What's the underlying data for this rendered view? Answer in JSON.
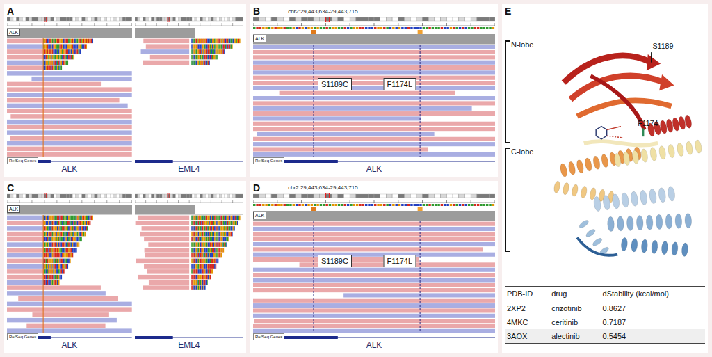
{
  "panels": [
    {
      "label": "A",
      "kind": "fusion",
      "regions": [
        {
          "gene": "ALK",
          "track": "ALK",
          "gene_track": "RefSeq Genes",
          "mode": "left",
          "split_reads": 6,
          "reads": [
            true,
            false,
            true,
            true,
            false,
            true,
            false,
            false,
            true,
            true,
            false,
            true,
            false,
            true,
            true,
            false,
            true,
            false,
            true,
            false,
            true,
            true
          ]
        },
        {
          "gene": "EML4",
          "track": "",
          "gene_track": "",
          "mode": "right",
          "split_reads": 5,
          "reads": [
            true,
            true,
            false,
            true,
            true,
            false,
            true,
            false,
            true,
            true,
            false,
            true,
            false,
            true,
            true,
            false,
            true,
            false,
            true,
            false,
            true,
            true
          ]
        }
      ]
    },
    {
      "label": "B",
      "kind": "variant",
      "coord": "chr2:29,443,634-29,443,715",
      "gene": "ALK",
      "track": "ALK",
      "gene_track": "RefSeq Genes",
      "variants": [
        {
          "label": "S1189C"
        },
        {
          "label": "F1174L"
        }
      ],
      "reads": [
        false,
        true,
        true,
        false,
        true,
        false,
        true,
        true,
        false,
        true,
        false,
        true,
        false,
        true,
        false,
        true,
        true,
        false,
        true,
        false,
        true,
        false
      ]
    },
    {
      "label": "C",
      "kind": "fusion",
      "regions": [
        {
          "gene": "ALK",
          "track": "ALK",
          "gene_track": "RefSeq Genes",
          "mode": "left",
          "split_reads": 13,
          "reads": [
            false,
            true,
            false,
            true,
            true,
            false,
            true,
            false,
            true,
            false,
            true,
            true,
            false,
            true,
            false,
            true,
            false,
            true,
            true,
            false,
            true,
            false
          ]
        },
        {
          "gene": "EML4",
          "track": "",
          "gene_track": "",
          "mode": "right",
          "split_reads": 14,
          "reads": [
            true,
            true,
            true,
            true,
            true,
            true,
            true,
            true,
            true,
            true,
            true,
            true,
            true,
            true,
            false,
            true,
            false,
            true,
            true,
            false,
            true,
            true
          ]
        }
      ]
    },
    {
      "label": "D",
      "kind": "variant",
      "coord": "chr2:29,443,634-29,443,715",
      "gene": "ALK",
      "track": "ALK",
      "gene_track": "RefSeq Genes",
      "variants": [
        {
          "label": "S1189C"
        },
        {
          "label": "F1174L"
        }
      ],
      "reads": [
        true,
        false,
        true,
        true,
        false,
        true,
        false,
        true,
        true,
        false,
        true,
        false,
        true,
        true,
        false,
        true,
        false,
        true,
        false,
        true,
        true,
        false
      ]
    },
    {
      "label": "E",
      "kind": "structure",
      "lobes": [
        "N-lobe",
        "C-lobe"
      ],
      "residues": [
        "S1189",
        "F1174"
      ],
      "table": {
        "columns": [
          "PDB-ID",
          "drug",
          "dStability (kcal/mol)"
        ],
        "rows": [
          [
            "2XP2",
            "crizotinib",
            "0.8627"
          ],
          [
            "4MKC",
            "ceritinib",
            "0.7187"
          ],
          [
            "3AOX",
            "alectinib",
            "0.5454"
          ]
        ]
      }
    }
  ]
}
